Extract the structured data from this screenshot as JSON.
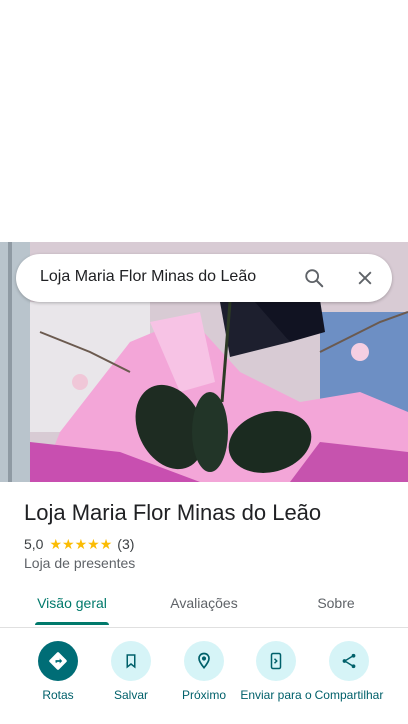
{
  "search": {
    "query": "Loja Maria Flor Minas do Leão"
  },
  "place": {
    "name": "Loja Maria Flor Minas do Leão",
    "rating": "5,0",
    "review_count": "(3)",
    "stars": 5,
    "category": "Loja de presentes"
  },
  "tabs": [
    {
      "label": "Visão geral",
      "active": true
    },
    {
      "label": "Avaliações",
      "active": false
    },
    {
      "label": "Sobre",
      "active": false
    }
  ],
  "actions": [
    {
      "label": "Rotas",
      "icon": "directions-icon"
    },
    {
      "label": "Salvar",
      "icon": "bookmark-icon"
    },
    {
      "label": "Próximo",
      "icon": "nearby-icon"
    },
    {
      "label": "Enviar para o",
      "icon": "send-to-phone-icon"
    },
    {
      "label": "Compartilhar",
      "icon": "share-icon"
    }
  ],
  "colors": {
    "accent": "#00796b",
    "primary_button": "#006d76",
    "action_bg": "#d6f4f7",
    "star": "#fbbc04"
  }
}
